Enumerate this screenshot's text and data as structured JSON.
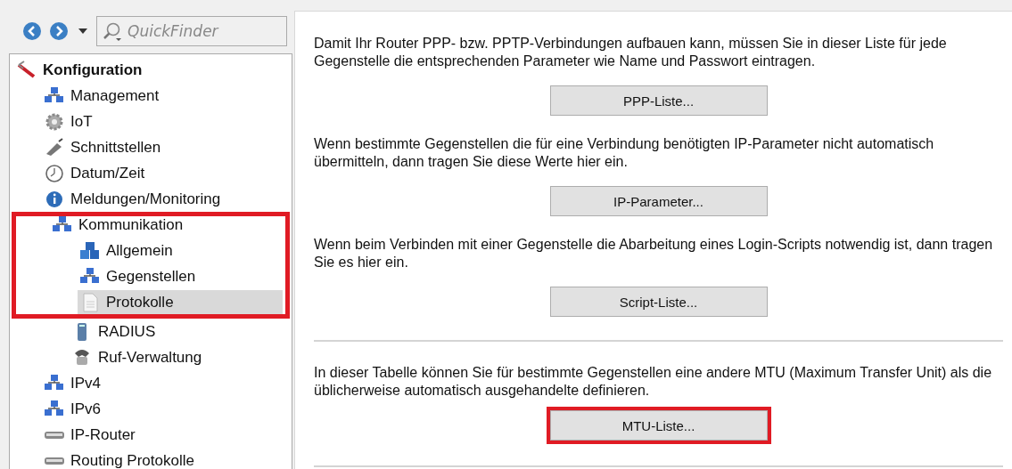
{
  "navigation": {
    "search": {
      "placeholder": "QuickFinder"
    }
  },
  "tree": [
    {
      "label": "Konfiguration",
      "selected": false,
      "highlighted": false,
      "children": [
        {
          "label": "Management",
          "selected": false,
          "highlighted": false
        },
        {
          "label": "IoT",
          "selected": false,
          "highlighted": false
        },
        {
          "label": "Schnittstellen",
          "selected": false,
          "highlighted": false
        },
        {
          "label": "Datum/Zeit",
          "selected": false,
          "highlighted": false
        },
        {
          "label": "Meldungen/Monitoring",
          "selected": false,
          "highlighted": false
        },
        {
          "label": "Kommunikation",
          "selected": false,
          "highlighted": true,
          "children": [
            {
              "label": "Allgemein",
              "selected": false,
              "highlighted": true
            },
            {
              "label": "Gegenstellen",
              "selected": false,
              "highlighted": true
            },
            {
              "label": "Protokolle",
              "selected": true,
              "highlighted": true
            },
            {
              "label": "RADIUS",
              "selected": false,
              "highlighted": false
            },
            {
              "label": "Ruf-Verwaltung",
              "selected": false,
              "highlighted": false
            }
          ]
        },
        {
          "label": "IPv4",
          "selected": false,
          "highlighted": false
        },
        {
          "label": "IPv6",
          "selected": false,
          "highlighted": false
        },
        {
          "label": "IP-Router",
          "selected": false,
          "highlighted": false
        },
        {
          "label": "Routing Protokolle",
          "selected": false,
          "highlighted": false
        }
      ]
    }
  ],
  "groups": [
    {
      "sections": [
        {
          "text": "Damit Ihr Router PPP- bzw. PPTP-Verbindungen aufbauen kann, müssen Sie in dieser Liste für jede Gegenstelle die entsprechenden Parameter wie Name und Passwort eintragen.",
          "button": {
            "label": "PPP-Liste...",
            "highlighted": false
          }
        },
        {
          "text": "Wenn bestimmte Gegenstellen die für eine Verbindung benötigten IP-Parameter nicht automatisch übermitteln, dann tragen Sie diese Werte hier ein.",
          "button": {
            "label": "IP-Parameter...",
            "highlighted": false
          }
        },
        {
          "text": "Wenn beim Verbinden mit einer Gegenstelle die Abarbeitung eines Login-Scripts notwendig ist, dann tragen Sie es hier ein.",
          "button": {
            "label": "Script-Liste...",
            "highlighted": false
          }
        }
      ]
    },
    {
      "sections": [
        {
          "text": "In dieser Tabelle können Sie für bestimmte Gegenstellen eine andere MTU (Maximum Transfer Unit) als die üblicherweise automatisch ausgehandelte definieren.",
          "button": {
            "label": "MTU-Liste...",
            "highlighted": true
          }
        }
      ]
    }
  ]
}
